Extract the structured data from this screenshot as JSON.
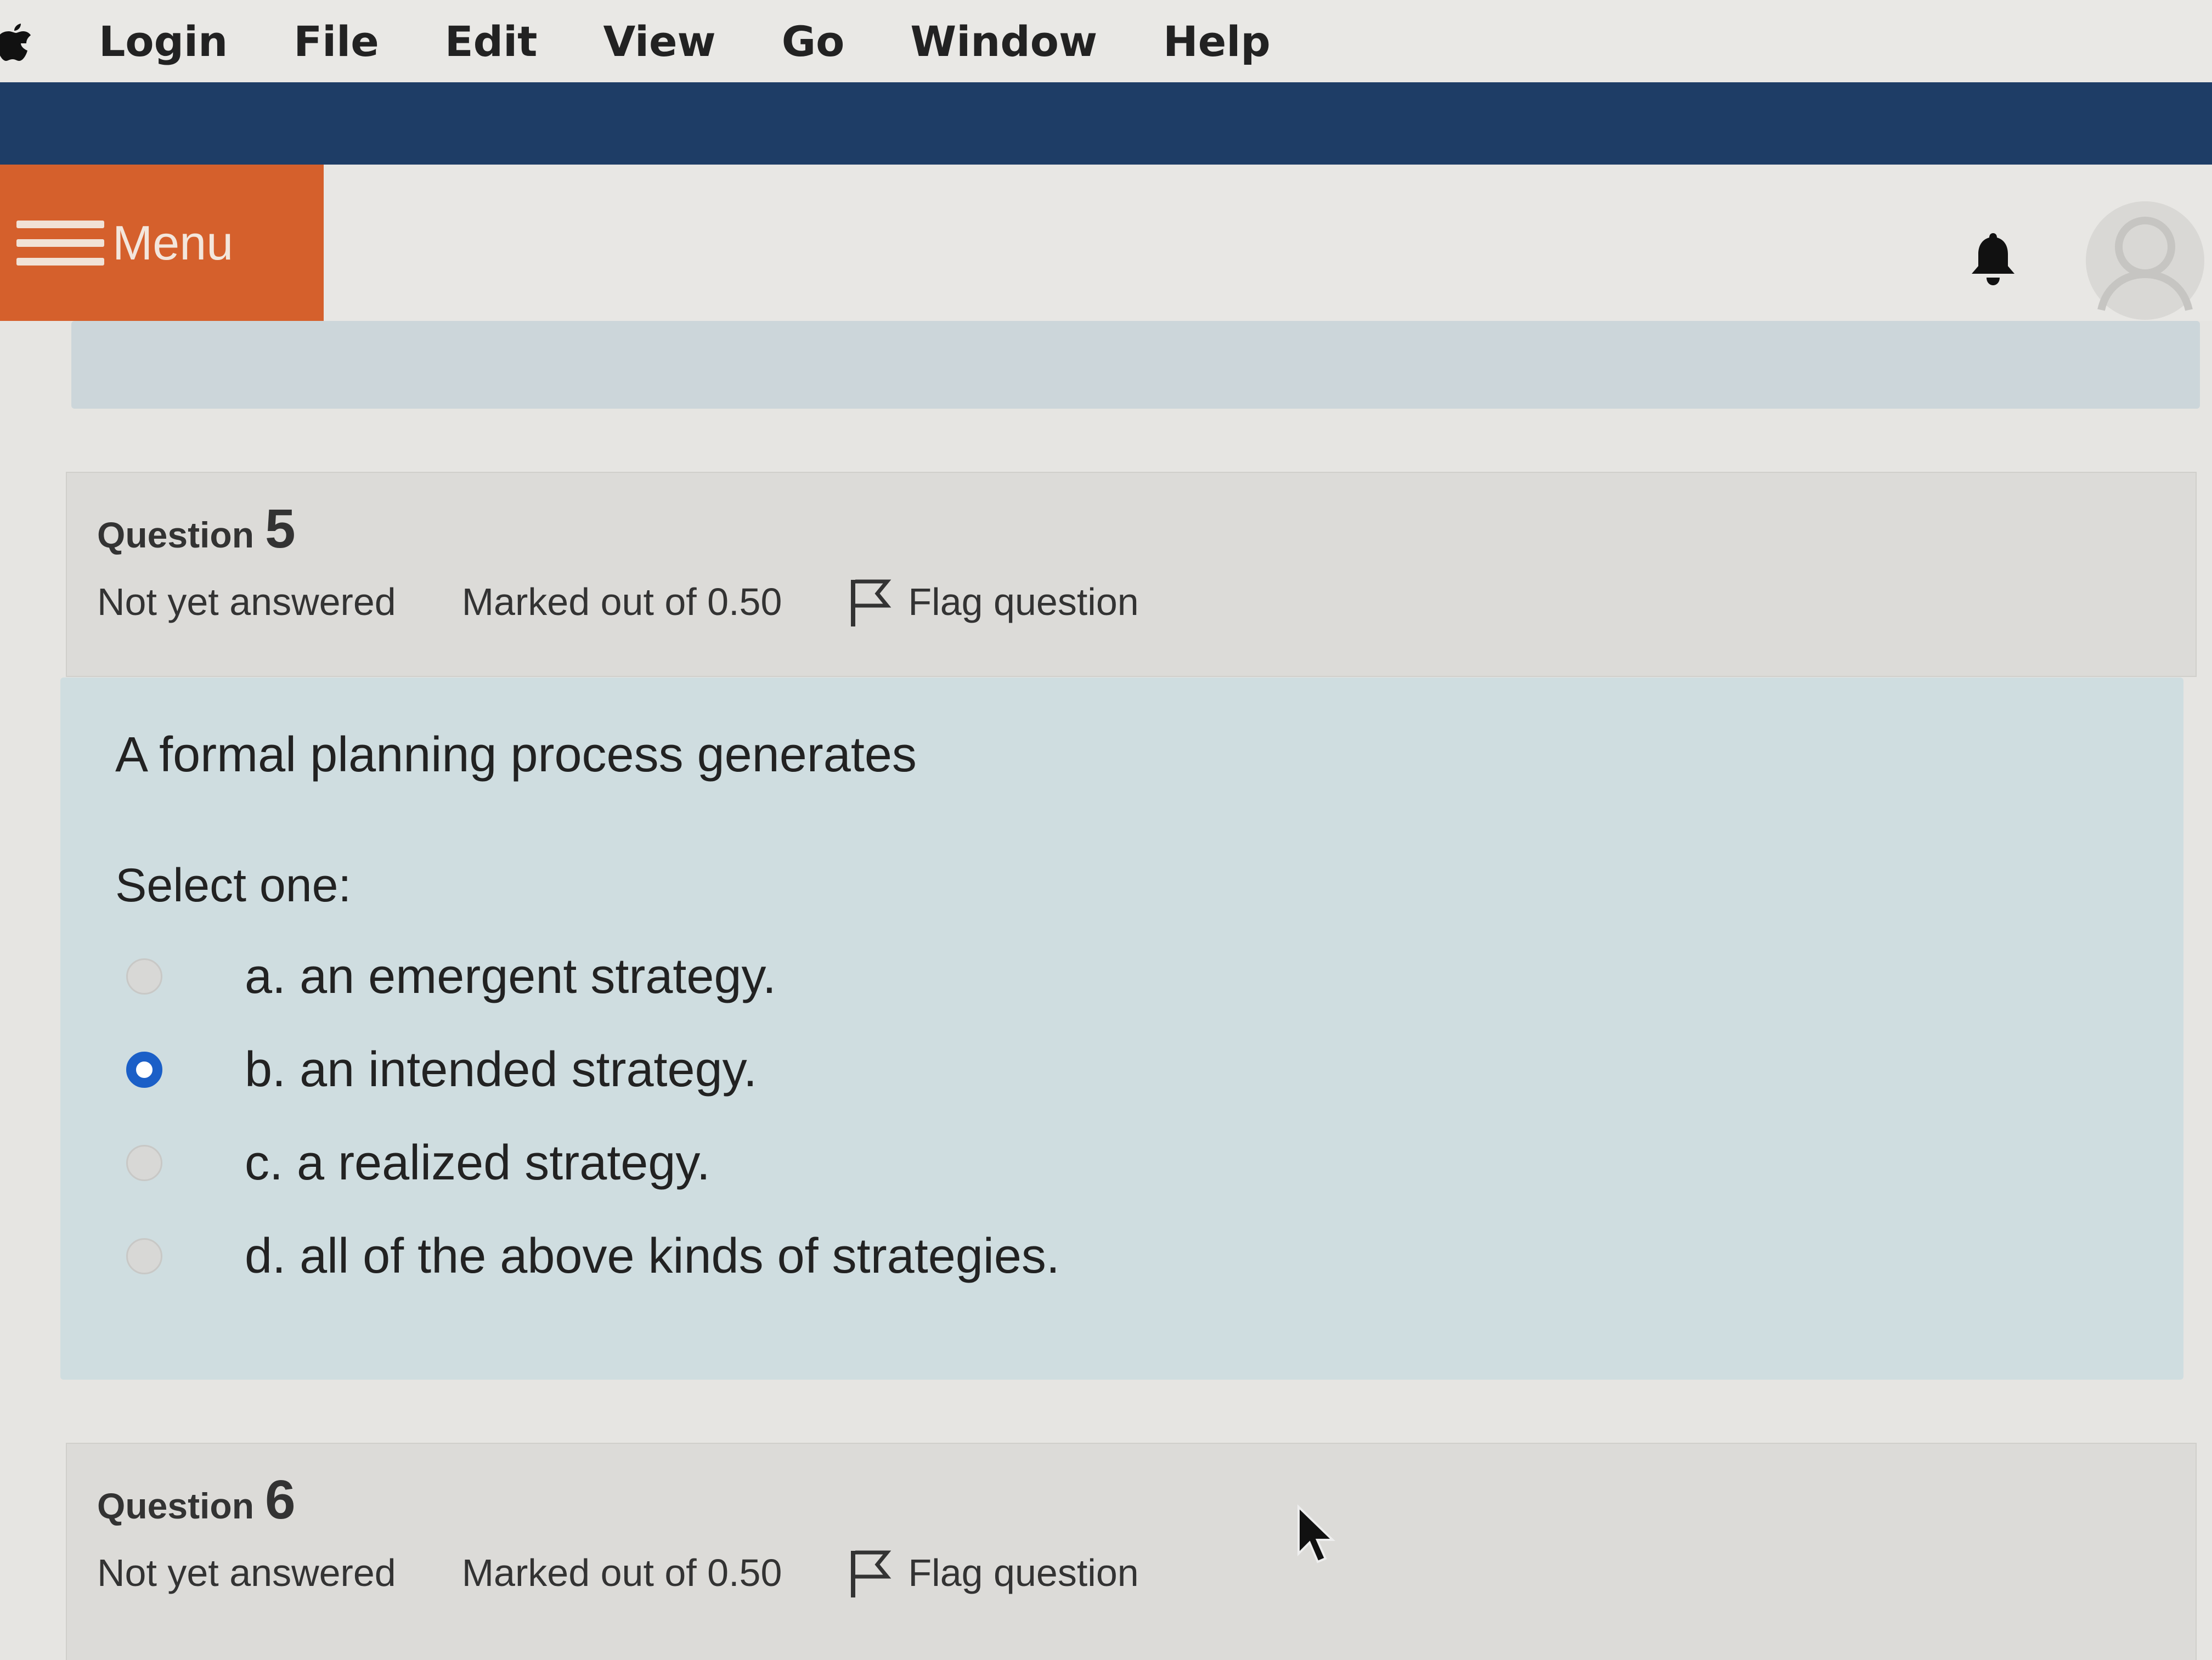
{
  "menubar": {
    "items": [
      "Login",
      "File",
      "Edit",
      "View",
      "Go",
      "Window",
      "Help"
    ]
  },
  "navbar": {
    "menu_label": "Menu"
  },
  "question5": {
    "label": "Question",
    "number": "5",
    "status": "Not yet answered",
    "marks": "Marked out of 0.50",
    "flag_label": "Flag question",
    "text": "A formal planning process generates",
    "prompt": "Select one:",
    "options": [
      {
        "label": "a. an emergent strategy.",
        "selected": false
      },
      {
        "label": "b. an intended strategy.",
        "selected": true
      },
      {
        "label": "c. a realized strategy.",
        "selected": false
      },
      {
        "label": "d. all of the above kinds of strategies.",
        "selected": false
      }
    ]
  },
  "question6": {
    "label": "Question",
    "number": "6",
    "status": "Not yet answered",
    "marks": "Marked out of 0.50",
    "flag_label": "Flag question"
  },
  "colors": {
    "menu_button": "#d5602c",
    "top_bar": "#1e3d66",
    "radio_selected": "#1b5fc7",
    "content_bg": "#cfdde0"
  }
}
